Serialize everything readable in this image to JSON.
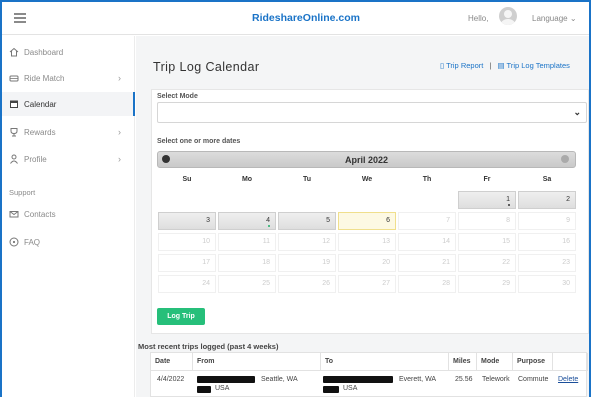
{
  "header": {
    "brand": "RideshareOnline.com",
    "greeting": "Hello,",
    "language": "Language",
    "language_caret": "⌄"
  },
  "sidebar": {
    "items": [
      {
        "label": "Dashboard",
        "icon": "home-icon"
      },
      {
        "label": "Ride Match",
        "icon": "car-icon",
        "chevron": "›"
      },
      {
        "label": "Calendar",
        "icon": "calendar-icon"
      },
      {
        "label": "Rewards",
        "icon": "trophy-icon",
        "chevron": "›"
      },
      {
        "label": "Profile",
        "icon": "person-icon",
        "chevron": "›"
      }
    ],
    "support_title": "Support",
    "support_items": [
      {
        "label": "Contacts",
        "icon": "mail-icon"
      },
      {
        "label": "FAQ",
        "icon": "question-icon"
      }
    ]
  },
  "main": {
    "title": "Trip Log Calendar",
    "trip_report": "Trip Report",
    "separator": "|",
    "trip_templates": "Trip Log Templates",
    "select_mode_label": "Select Mode",
    "select_mode_value": "",
    "dates_label": "Select one or more dates",
    "log_trip_button": "Log Trip"
  },
  "calendar": {
    "month": "April 2022",
    "days_of_week": [
      "Su",
      "Mo",
      "Tu",
      "We",
      "Th",
      "Fr",
      "Sa"
    ],
    "weeks": [
      [
        null,
        null,
        null,
        null,
        null,
        {
          "d": "1",
          "en": true,
          "dot": "dark"
        },
        {
          "d": "2",
          "en": true
        }
      ],
      [
        {
          "d": "3",
          "en": true
        },
        {
          "d": "4",
          "en": true,
          "dot": "green"
        },
        {
          "d": "5",
          "en": true
        },
        {
          "d": "6",
          "today": true
        },
        {
          "d": "7"
        },
        {
          "d": "8"
        },
        {
          "d": "9"
        }
      ],
      [
        {
          "d": "10"
        },
        {
          "d": "11"
        },
        {
          "d": "12"
        },
        {
          "d": "13"
        },
        {
          "d": "14"
        },
        {
          "d": "15"
        },
        {
          "d": "16"
        }
      ],
      [
        {
          "d": "17"
        },
        {
          "d": "18"
        },
        {
          "d": "19"
        },
        {
          "d": "20"
        },
        {
          "d": "21"
        },
        {
          "d": "22"
        },
        {
          "d": "23"
        }
      ],
      [
        {
          "d": "24"
        },
        {
          "d": "25"
        },
        {
          "d": "26"
        },
        {
          "d": "27"
        },
        {
          "d": "28"
        },
        {
          "d": "29"
        },
        {
          "d": "30"
        }
      ]
    ]
  },
  "recent_trips": {
    "title": "Most recent trips logged (past 4 weeks)",
    "columns": [
      "Date",
      "From",
      "To",
      "Miles",
      "Mode",
      "Purpose",
      ""
    ],
    "rows": [
      {
        "date": "4/4/2022",
        "from_city": "Seattle, WA",
        "from_country": "USA",
        "to_city": "Everett, WA",
        "to_country": "USA",
        "miles": "25.56",
        "mode": "Telework",
        "purpose": "Commute",
        "action": "Delete"
      }
    ]
  },
  "colors": {
    "accent": "#1a73c7",
    "log_button": "#26bf7a",
    "today_bg": "#fdf9e3",
    "background": "#f4f5f6"
  }
}
